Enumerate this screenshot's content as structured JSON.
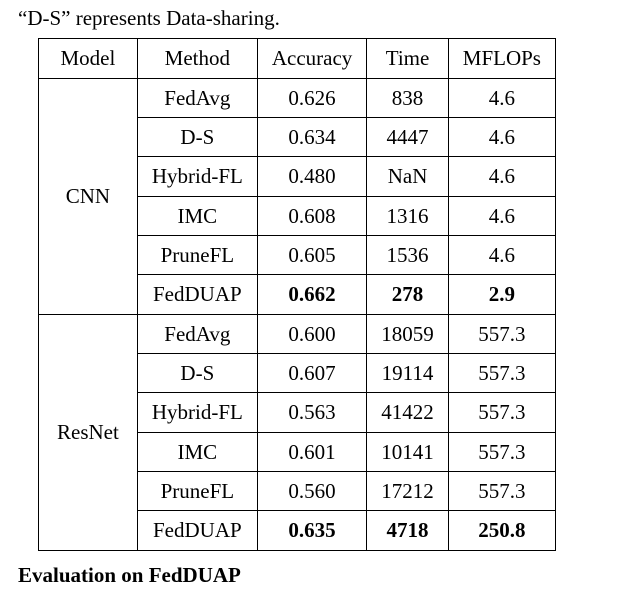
{
  "caption": "“D-S” represents Data-sharing.",
  "section_heading": "Evaluation on FedDUAP",
  "headers": {
    "model": "Model",
    "method": "Method",
    "accuracy": "Accuracy",
    "time": "Time",
    "mflops": "MFLOPs"
  },
  "groups": [
    {
      "model": "CNN",
      "rows": [
        {
          "method": "FedAvg",
          "accuracy": "0.626",
          "time": "838",
          "mflops": "4.6",
          "bold": false
        },
        {
          "method": "D-S",
          "accuracy": "0.634",
          "time": "4447",
          "mflops": "4.6",
          "bold": false
        },
        {
          "method": "Hybrid-FL",
          "accuracy": "0.480",
          "time": "NaN",
          "mflops": "4.6",
          "bold": false
        },
        {
          "method": "IMC",
          "accuracy": "0.608",
          "time": "1316",
          "mflops": "4.6",
          "bold": false
        },
        {
          "method": "PruneFL",
          "accuracy": "0.605",
          "time": "1536",
          "mflops": "4.6",
          "bold": false
        },
        {
          "method": "FedDUAP",
          "accuracy": "0.662",
          "time": "278",
          "mflops": "2.9",
          "bold": true
        }
      ]
    },
    {
      "model": "ResNet",
      "rows": [
        {
          "method": "FedAvg",
          "accuracy": "0.600",
          "time": "18059",
          "mflops": "557.3",
          "bold": false
        },
        {
          "method": "D-S",
          "accuracy": "0.607",
          "time": "19114",
          "mflops": "557.3",
          "bold": false
        },
        {
          "method": "Hybrid-FL",
          "accuracy": "0.563",
          "time": "41422",
          "mflops": "557.3",
          "bold": false
        },
        {
          "method": "IMC",
          "accuracy": "0.601",
          "time": "10141",
          "mflops": "557.3",
          "bold": false
        },
        {
          "method": "PruneFL",
          "accuracy": "0.560",
          "time": "17212",
          "mflops": "557.3",
          "bold": false
        },
        {
          "method": "FedDUAP",
          "accuracy": "0.635",
          "time": "4718",
          "mflops": "250.8",
          "bold": true
        }
      ]
    }
  ]
}
